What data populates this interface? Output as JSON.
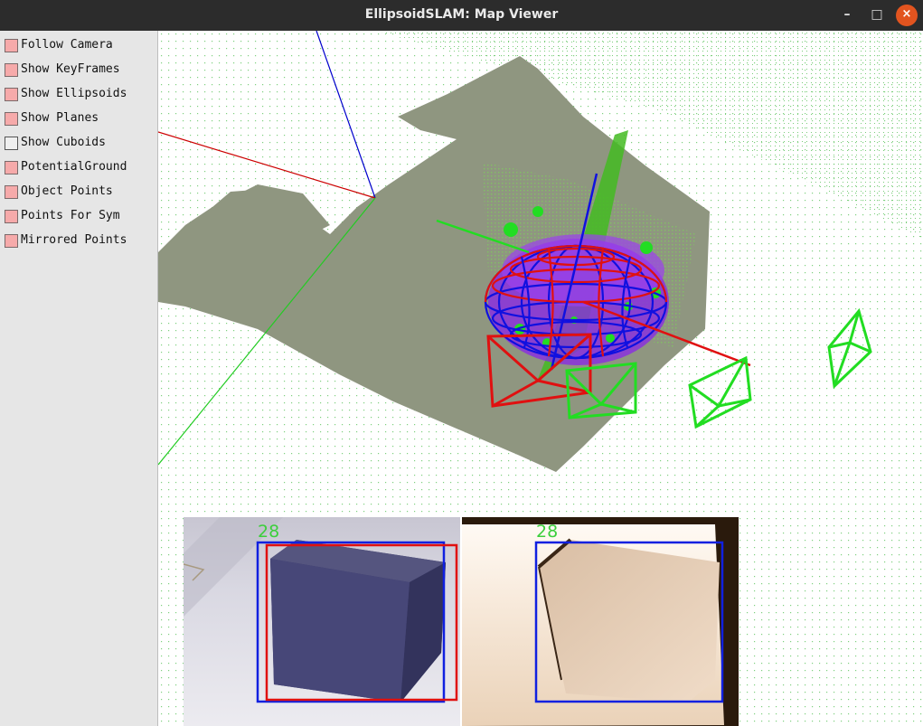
{
  "window": {
    "title": "EllipsoidSLAM: Map Viewer"
  },
  "window_controls": {
    "minimize": "–",
    "maximize": "□",
    "close": "×"
  },
  "menu": {
    "items": [
      {
        "label": "Follow Camera",
        "checked": true
      },
      {
        "label": "Show KeyFrames",
        "checked": true
      },
      {
        "label": "Show Ellipsoids",
        "checked": true
      },
      {
        "label": "Show Planes",
        "checked": true
      },
      {
        "label": "Show Cuboids",
        "checked": false
      },
      {
        "label": "PotentialGround",
        "checked": true
      },
      {
        "label": "Object Points",
        "checked": true
      },
      {
        "label": "Points For Sym",
        "checked": true
      },
      {
        "label": "Mirrored Points",
        "checked": true
      }
    ]
  },
  "views": {
    "rgb_image": {
      "object_id": "28"
    },
    "depth_image": {
      "object_id": "28"
    }
  },
  "colors": {
    "checked": "#f6aaaa",
    "ground": "#8f9680",
    "ellipsoid": "#1010e0",
    "ellipsoid_top": "#e01010",
    "object_points": "#8a2be2",
    "keyframe": "#22dd22",
    "current_frame": "#e01010",
    "bbox_detection": "#1020e0",
    "bbox_projection": "#e01010",
    "id_label": "#3ccf3c"
  }
}
